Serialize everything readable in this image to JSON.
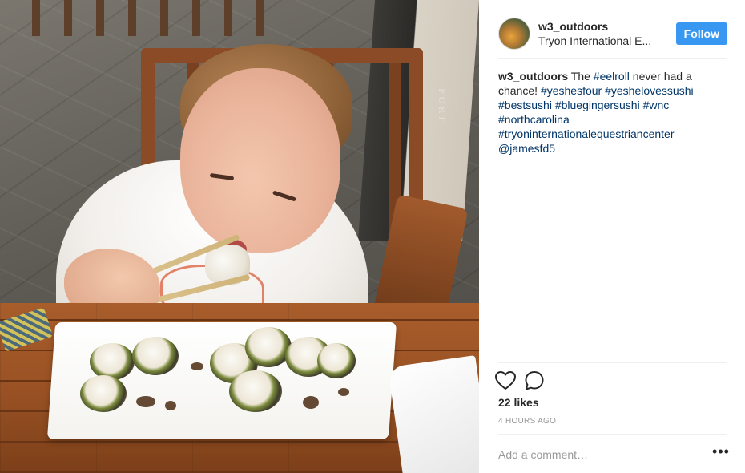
{
  "post": {
    "photo": {
      "description_icon": "post-photo",
      "sign_text": "FORT"
    },
    "header": {
      "username": "w3_outdoors",
      "location": "Tryon International E...",
      "follow_label": "Follow",
      "follow_color": "#3897f0"
    },
    "caption": {
      "username": "w3_outdoors",
      "text_before": "The ",
      "text_after_tag1": " never had a chance! ",
      "hashtags": [
        "#eelroll",
        "#yeshesfour",
        "#yeshelovessushi",
        "#bestsushi",
        "#bluegingersushi",
        "#wnc",
        "#northcarolina",
        "#tryoninternationalequestriancenter"
      ],
      "mention": "@jamesfd5",
      "link_color": "#003569"
    },
    "actions": {
      "like_icon": "heart-outline-icon",
      "comment_icon": "speech-bubble-icon"
    },
    "likes": "22 likes",
    "timestamp": "4 HOURS AGO",
    "comment": {
      "placeholder": "Add a comment…",
      "more_label": "•••"
    }
  }
}
